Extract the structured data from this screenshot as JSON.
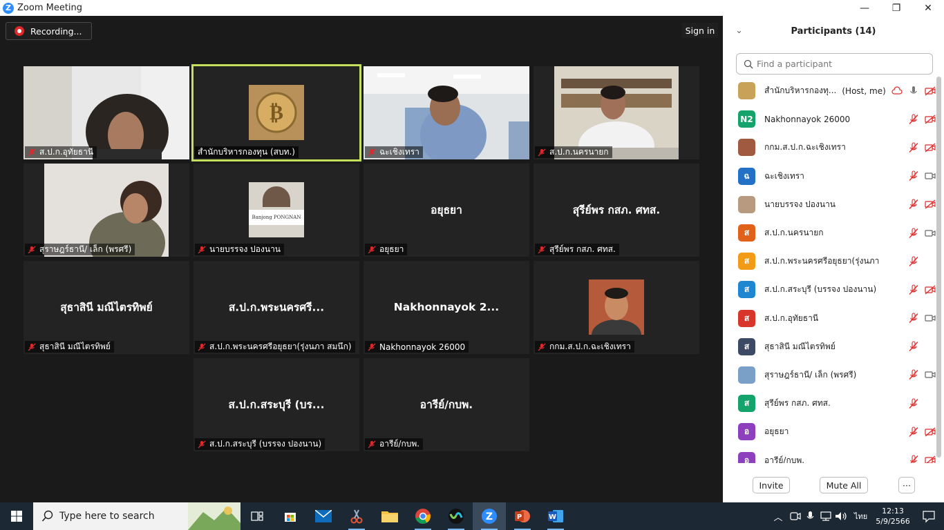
{
  "window": {
    "title": "Zoom Meeting",
    "min": "—",
    "max": "❐",
    "close": "✕"
  },
  "meeting": {
    "recording_label": "Recording...",
    "signin_label": "Sign in",
    "tiles": [
      {
        "caption": "ส.ป.ก.อุทัยธานี",
        "big": ""
      },
      {
        "caption": "สำนักบริหารกองทุน (สบท.)",
        "big": ""
      },
      {
        "caption": "ฉะเชิงเทรา",
        "big": ""
      },
      {
        "caption": "ส.ป.ก.นครนายก",
        "big": ""
      },
      {
        "caption": "สุราษฎร์ธานี/ เล็ก (พรศรี)",
        "big": ""
      },
      {
        "caption": "นายบรรจง ปองนาน",
        "big": "",
        "nameplate": "Banjong PONGNAN"
      },
      {
        "caption": "อยุธยา",
        "big": "อยุธยา"
      },
      {
        "caption": "สุรีย์พร กสภ. ศทส.",
        "big": "สุรีย์พร กสภ. ศทส."
      },
      {
        "caption": "สุธาสินี มณีไตรทิพย์",
        "big": "สุธาสินี มณีไตรทิพย์"
      },
      {
        "caption": "ส.ป.ก.พระนครศรีอยุธยา(รุ่งนภา สมนึก)",
        "big": "ส.ป.ก.พระนครศรี..."
      },
      {
        "caption": "Nakhonnayok 26000",
        "big": "Nakhonnayok  2..."
      },
      {
        "caption": "กกม.ส.ป.ก.ฉะเชิงเทรา",
        "big": ""
      },
      {
        "caption": "ส.ป.ก.สระบุรี (บรรจง ปองนาน)",
        "big": "ส.ป.ก.สระบุรี (บร..."
      },
      {
        "caption": "อารีย์/กบพ.",
        "big": "อารีย์/กบพ."
      }
    ]
  },
  "participants": {
    "header": "Participants (14)",
    "search_placeholder": "Find a participant",
    "list": [
      {
        "name": "สำนักบริหารกองทุ...",
        "role": "(Host, me)",
        "avatar": "",
        "color": "#c9a25a"
      },
      {
        "name": "Nakhonnayok 26000",
        "role": "",
        "avatar": "N2",
        "color": "#13a36b"
      },
      {
        "name": "กกม.ส.ป.ก.ฉะเชิงเทรา",
        "role": "",
        "avatar": "",
        "color": "#a05a40"
      },
      {
        "name": "ฉะเชิงเทรา",
        "role": "",
        "avatar": "ฉ",
        "color": "#2370c7"
      },
      {
        "name": "นายบรรจง ปองนาน",
        "role": "",
        "avatar": "",
        "color": "#b89a80"
      },
      {
        "name": "ส.ป.ก.นครนายก",
        "role": "",
        "avatar": "ส",
        "color": "#e0621a"
      },
      {
        "name": "ส.ป.ก.พระนครศรีอยุธยา(รุ่งนภา สมนึก)",
        "role": "",
        "avatar": "ส",
        "color": "#f29b16"
      },
      {
        "name": "ส.ป.ก.สระบุรี (บรรจง ปองนาน)",
        "role": "",
        "avatar": "ส",
        "color": "#1f86d1"
      },
      {
        "name": "ส.ป.ก.อุทัยธานี",
        "role": "",
        "avatar": "ส",
        "color": "#d9362b"
      },
      {
        "name": "สุธาสินี มณีไตรทิพย์",
        "role": "",
        "avatar": "ส",
        "color": "#3c4a63"
      },
      {
        "name": "สุราษฎร์ธานี/ เล็ก (พรศรี)",
        "role": "",
        "avatar": "",
        "color": "#7aa0c8"
      },
      {
        "name": "สุรีย์พร กสภ. ศทส.",
        "role": "",
        "avatar": "ส",
        "color": "#13a36b"
      },
      {
        "name": "อยุธยา",
        "role": "",
        "avatar": "อ",
        "color": "#8e3fbd"
      },
      {
        "name": "อารีย์/กบพ.",
        "role": "",
        "avatar": "อ",
        "color": "#8e3fbd"
      }
    ],
    "invite_label": "Invite",
    "mute_all_label": "Mute All",
    "more_label": "···"
  },
  "taskbar": {
    "search_placeholder": "Type here to search",
    "lang": "ไทย",
    "time": "12:13",
    "date": "5/9/2566"
  },
  "colors": {
    "active_speaker": "#c5e05a",
    "muted": "#e02828",
    "zoom_blue": "#2d8cff"
  }
}
